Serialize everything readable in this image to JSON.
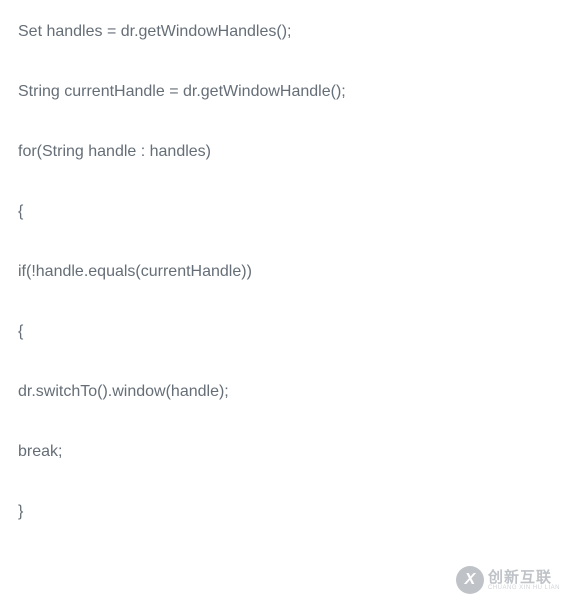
{
  "code": {
    "lines": [
      "Set handles = dr.getWindowHandles();",
      "String currentHandle = dr.getWindowHandle();",
      "for(String handle : handles)",
      "{",
      "if(!handle.equals(currentHandle))",
      "{",
      "dr.switchTo().window(handle);",
      "break;",
      "}"
    ]
  },
  "watermark": {
    "logo_letter": "X",
    "main_text": "创新互联",
    "sub_text": "CHUANG XIN HU LIAN"
  }
}
